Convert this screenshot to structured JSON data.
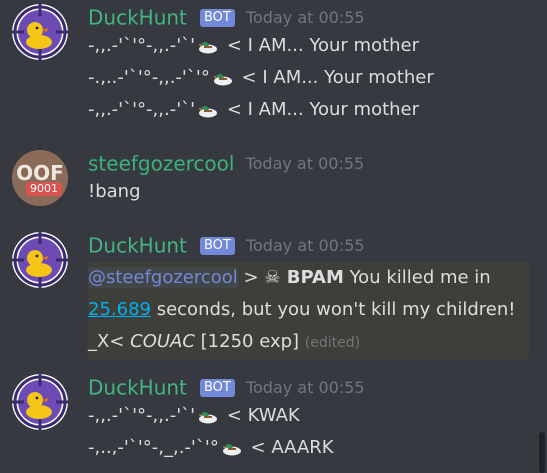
{
  "messages": [
    {
      "username": "DuckHunt",
      "bot_tag": "BOT",
      "timestamp": "Today at 00:55",
      "lines": [
        {
          "prefix": "-,,.-'`'°-,,.-'`'",
          "suffix": " < I AM... Your mother"
        },
        {
          "prefix": "-.,..-'`'°-,,.-'`'°",
          "suffix": " < I AM... Your mother"
        },
        {
          "prefix": "-,,.-'`'°-,,.-'`'",
          "suffix": " < I AM... Your mother"
        }
      ]
    },
    {
      "username": "steefgozercool",
      "timestamp": "Today at 00:55",
      "badge": "9001",
      "avatar_text": "OOF",
      "lines": [
        {
          "text": "!bang"
        }
      ]
    },
    {
      "username": "DuckHunt",
      "bot_tag": "BOT",
      "timestamp": "Today at 00:55",
      "embed": {
        "mention": "@steefgozercool",
        "arrow": " > ",
        "skull": "☠",
        "bpam": " BPAM",
        "text1": " You killed me in",
        "link": "25.689",
        "text2": " seconds, but you won't kill my children!",
        "line3_a": "_X<  ",
        "line3_b": "COUAC",
        "line3_c": "  [1250 exp] ",
        "edited": "(edited)"
      }
    },
    {
      "username": "DuckHunt",
      "bot_tag": "BOT",
      "timestamp": "Today at 00:55",
      "lines": [
        {
          "prefix": "-,,.-'`'°-,,.-'`'",
          "suffix": " < KWAK"
        },
        {
          "prefix": "-,..,-'`'°-,_,.-'`'°",
          "suffix": " < AAARK"
        }
      ]
    }
  ],
  "colors": {
    "background": "#36393f",
    "username": "#43b581",
    "bot_tag": "#7289da",
    "mention": "#7289da",
    "link": "#00b0f4"
  }
}
